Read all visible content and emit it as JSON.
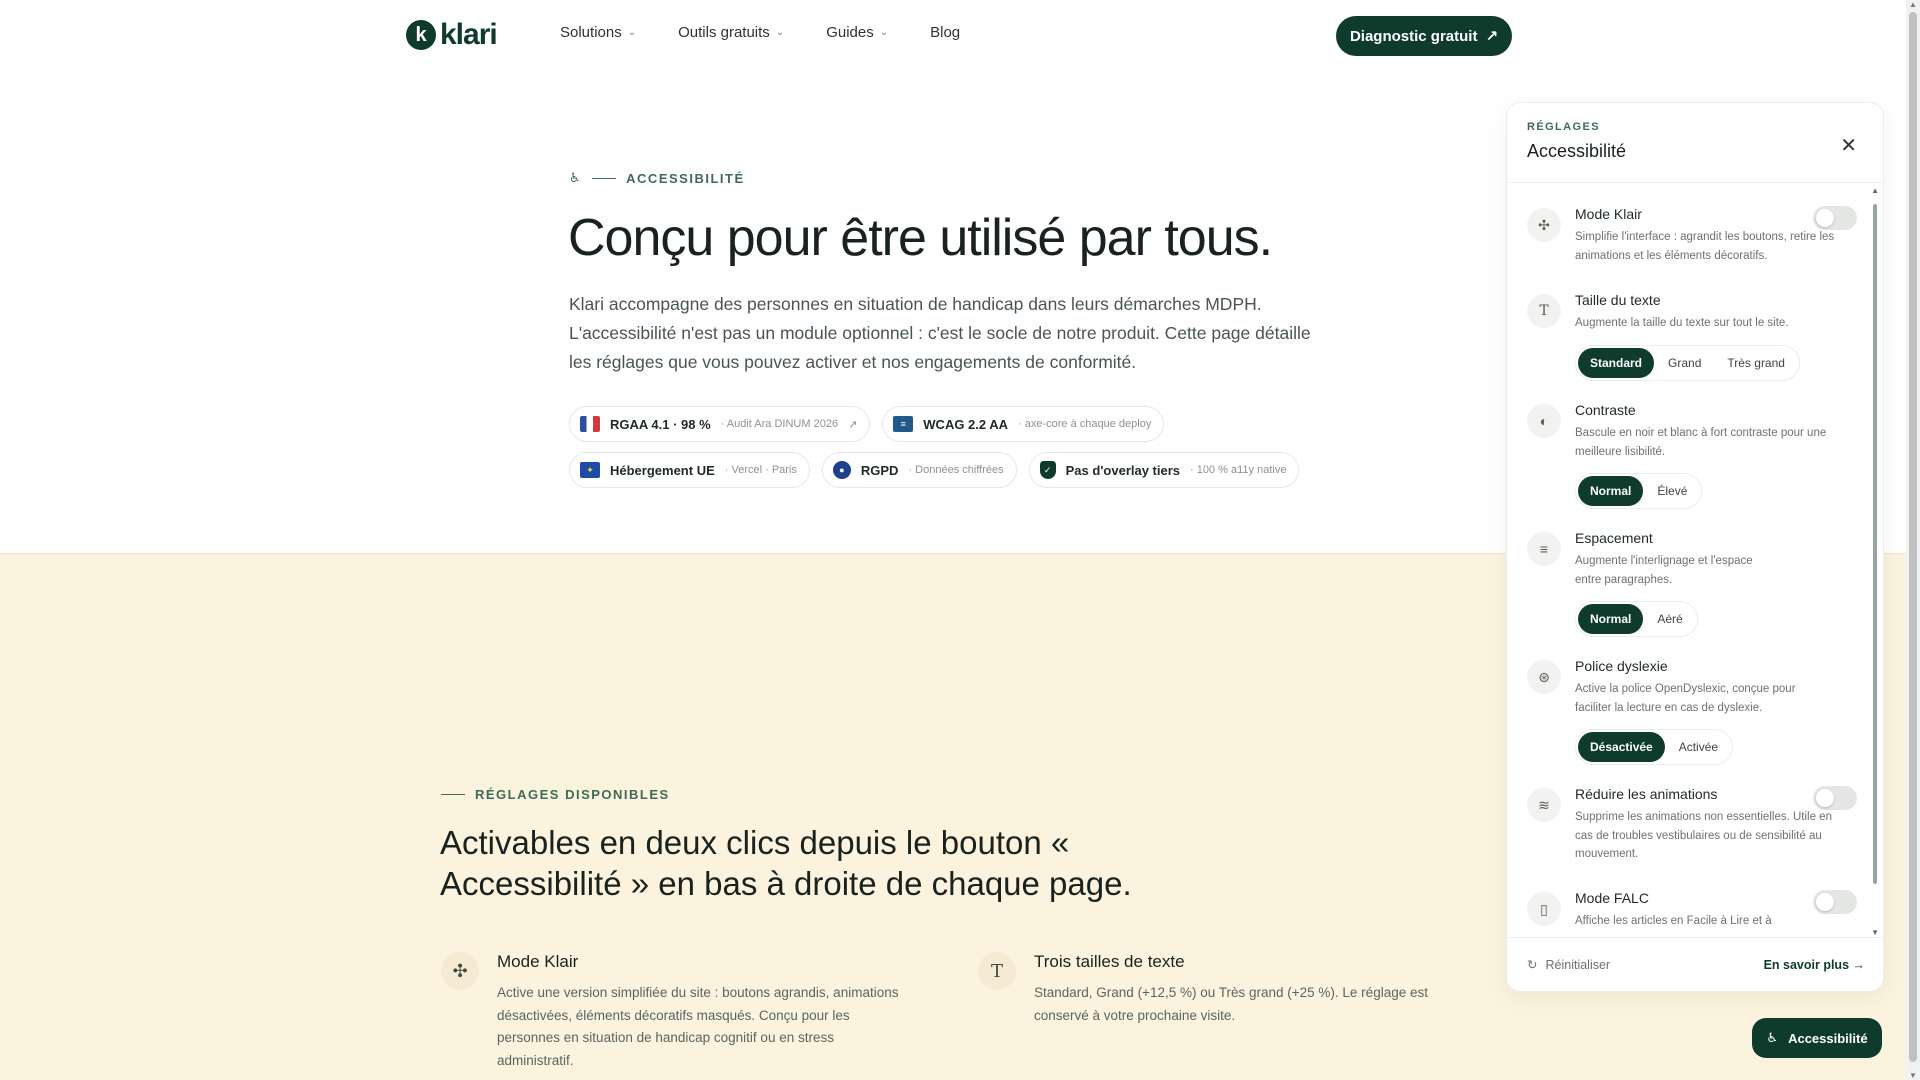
{
  "nav": {
    "logo_mark": "k",
    "logo_text": "klari",
    "links": [
      {
        "label": "Solutions",
        "has_menu": true
      },
      {
        "label": "Outils gratuits",
        "has_menu": true
      },
      {
        "label": "Guides",
        "has_menu": true
      },
      {
        "label": "Blog",
        "has_menu": false
      }
    ],
    "cta_label": "Diagnostic gratuit",
    "cta_icon": "↗"
  },
  "hero": {
    "eyebrow": "ACCESSIBILITÉ",
    "eyebrow_icon": "♿",
    "title": "Conçu pour être utilisé par tous.",
    "text": "Klari accompagne des personnes en situation de handicap dans leurs démarches MDPH. L'accessibilité n'est pas un module optionnel : c'est le socle de notre produit. Cette page détaille les réglages que vous pouvez activer et nos engagements de conformité.",
    "badges": [
      {
        "title": "RGAA 4.1 · 98 %",
        "sub": "· Audit Ara DINUM 2026",
        "ext": "↗",
        "icon": "fr-flag-icon",
        "color": "#2b4fa0"
      },
      {
        "title": "WCAG 2.2 AA",
        "sub": "· axe-core à chaque deploy",
        "ext": "",
        "icon": "wcag-icon",
        "color": "#1f5a8a"
      },
      {
        "title": "Hébergement UE",
        "sub": "· Vercel · Paris",
        "ext": "",
        "icon": "eu-flag-icon",
        "color": "#1f4aa8"
      },
      {
        "title": "RGPD",
        "sub": "· Données chiffrées",
        "ext": "",
        "icon": "rgpd-icon",
        "color": "#1f3f8f"
      },
      {
        "title": "Pas d'overlay tiers",
        "sub": "· 100 % a11y native",
        "ext": "",
        "icon": "shield-icon",
        "color": "#0f3b2c"
      }
    ]
  },
  "section": {
    "eyebrow": "RÉGLAGES DISPONIBLES",
    "title": "Activables en deux clics depuis le bouton « Accessibilité » en bas à droite de chaque page.",
    "features": [
      {
        "icon": "✣",
        "title": "Mode Klair",
        "text": "Active une version simplifiée du site : boutons agrandis, animations désactivées, éléments décoratifs masqués. Conçu pour les personnes en situation de handicap cognitif ou en stress administratif."
      },
      {
        "icon": "T",
        "title": "Trois tailles de texte",
        "text": "Standard, Grand (+12,5 %) ou Très grand (+25 %). Le réglage est conservé à votre prochaine visite."
      }
    ]
  },
  "panel": {
    "eyebrow": "RÉGLAGES",
    "title": "Accessibilité",
    "close": "✕",
    "settings": {
      "mode_klair": {
        "icon": "✣",
        "title": "Mode Klair",
        "desc": "Simplifie l'interface : agrandit les boutons, retire les animations et les éléments décoratifs.",
        "on": false
      },
      "taille": {
        "icon": "T",
        "title": "Taille du texte",
        "desc": "Augmente la taille du texte sur tout le site.",
        "options": [
          "Standard",
          "Grand",
          "Très grand"
        ],
        "selected": "Standard"
      },
      "contraste": {
        "icon": "◐",
        "title": "Contraste",
        "desc": "Bascule en noir et blanc à fort contraste pour une meilleure lisibilité.",
        "options": [
          "Normal",
          "Élevé"
        ],
        "selected": "Normal"
      },
      "espacement": {
        "icon": "≡",
        "title": "Espacement",
        "desc": "Augmente l'interlignage et l'espace entre paragraphes.",
        "options": [
          "Normal",
          "Aéré"
        ],
        "selected": "Normal"
      },
      "dyslexie": {
        "icon": "⊛",
        "title": "Police dyslexie",
        "desc": "Active la police OpenDyslexic, conçue pour faciliter la lecture en cas de dyslexie.",
        "options": [
          "Désactivée",
          "Activée"
        ],
        "selected": "Désactivée"
      },
      "animations": {
        "icon": "≋",
        "title": "Réduire les animations",
        "desc": "Supprime les animations non essentielles. Utile en cas de troubles vestibulaires ou de sensibilité au mouvement.",
        "on": false
      },
      "falc": {
        "icon": "▯",
        "title": "Mode FALC",
        "desc": "Affiche les articles en Facile à Lire et à",
        "on": false
      }
    },
    "reset_label": "Réinitialiser",
    "reset_icon": "↻",
    "learn_label": "En savoir plus →"
  },
  "a11y_button": {
    "label": "Accessibilité",
    "icon": "♿"
  }
}
